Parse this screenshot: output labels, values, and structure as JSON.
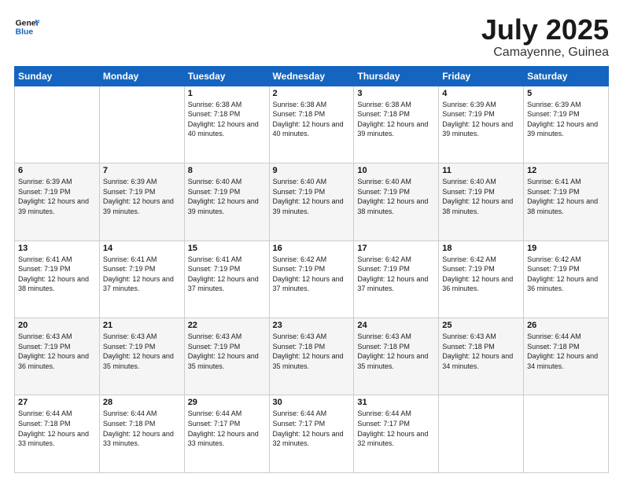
{
  "header": {
    "logo_line1": "General",
    "logo_line2": "Blue",
    "month_title": "July 2025",
    "location": "Camayenne, Guinea"
  },
  "days_of_week": [
    "Sunday",
    "Monday",
    "Tuesday",
    "Wednesday",
    "Thursday",
    "Friday",
    "Saturday"
  ],
  "weeks": [
    [
      {
        "day": "",
        "sunrise": "",
        "sunset": "",
        "daylight": ""
      },
      {
        "day": "",
        "sunrise": "",
        "sunset": "",
        "daylight": ""
      },
      {
        "day": "1",
        "sunrise": "Sunrise: 6:38 AM",
        "sunset": "Sunset: 7:18 PM",
        "daylight": "Daylight: 12 hours and 40 minutes."
      },
      {
        "day": "2",
        "sunrise": "Sunrise: 6:38 AM",
        "sunset": "Sunset: 7:18 PM",
        "daylight": "Daylight: 12 hours and 40 minutes."
      },
      {
        "day": "3",
        "sunrise": "Sunrise: 6:38 AM",
        "sunset": "Sunset: 7:18 PM",
        "daylight": "Daylight: 12 hours and 39 minutes."
      },
      {
        "day": "4",
        "sunrise": "Sunrise: 6:39 AM",
        "sunset": "Sunset: 7:19 PM",
        "daylight": "Daylight: 12 hours and 39 minutes."
      },
      {
        "day": "5",
        "sunrise": "Sunrise: 6:39 AM",
        "sunset": "Sunset: 7:19 PM",
        "daylight": "Daylight: 12 hours and 39 minutes."
      }
    ],
    [
      {
        "day": "6",
        "sunrise": "Sunrise: 6:39 AM",
        "sunset": "Sunset: 7:19 PM",
        "daylight": "Daylight: 12 hours and 39 minutes."
      },
      {
        "day": "7",
        "sunrise": "Sunrise: 6:39 AM",
        "sunset": "Sunset: 7:19 PM",
        "daylight": "Daylight: 12 hours and 39 minutes."
      },
      {
        "day": "8",
        "sunrise": "Sunrise: 6:40 AM",
        "sunset": "Sunset: 7:19 PM",
        "daylight": "Daylight: 12 hours and 39 minutes."
      },
      {
        "day": "9",
        "sunrise": "Sunrise: 6:40 AM",
        "sunset": "Sunset: 7:19 PM",
        "daylight": "Daylight: 12 hours and 39 minutes."
      },
      {
        "day": "10",
        "sunrise": "Sunrise: 6:40 AM",
        "sunset": "Sunset: 7:19 PM",
        "daylight": "Daylight: 12 hours and 38 minutes."
      },
      {
        "day": "11",
        "sunrise": "Sunrise: 6:40 AM",
        "sunset": "Sunset: 7:19 PM",
        "daylight": "Daylight: 12 hours and 38 minutes."
      },
      {
        "day": "12",
        "sunrise": "Sunrise: 6:41 AM",
        "sunset": "Sunset: 7:19 PM",
        "daylight": "Daylight: 12 hours and 38 minutes."
      }
    ],
    [
      {
        "day": "13",
        "sunrise": "Sunrise: 6:41 AM",
        "sunset": "Sunset: 7:19 PM",
        "daylight": "Daylight: 12 hours and 38 minutes."
      },
      {
        "day": "14",
        "sunrise": "Sunrise: 6:41 AM",
        "sunset": "Sunset: 7:19 PM",
        "daylight": "Daylight: 12 hours and 37 minutes."
      },
      {
        "day": "15",
        "sunrise": "Sunrise: 6:41 AM",
        "sunset": "Sunset: 7:19 PM",
        "daylight": "Daylight: 12 hours and 37 minutes."
      },
      {
        "day": "16",
        "sunrise": "Sunrise: 6:42 AM",
        "sunset": "Sunset: 7:19 PM",
        "daylight": "Daylight: 12 hours and 37 minutes."
      },
      {
        "day": "17",
        "sunrise": "Sunrise: 6:42 AM",
        "sunset": "Sunset: 7:19 PM",
        "daylight": "Daylight: 12 hours and 37 minutes."
      },
      {
        "day": "18",
        "sunrise": "Sunrise: 6:42 AM",
        "sunset": "Sunset: 7:19 PM",
        "daylight": "Daylight: 12 hours and 36 minutes."
      },
      {
        "day": "19",
        "sunrise": "Sunrise: 6:42 AM",
        "sunset": "Sunset: 7:19 PM",
        "daylight": "Daylight: 12 hours and 36 minutes."
      }
    ],
    [
      {
        "day": "20",
        "sunrise": "Sunrise: 6:43 AM",
        "sunset": "Sunset: 7:19 PM",
        "daylight": "Daylight: 12 hours and 36 minutes."
      },
      {
        "day": "21",
        "sunrise": "Sunrise: 6:43 AM",
        "sunset": "Sunset: 7:19 PM",
        "daylight": "Daylight: 12 hours and 35 minutes."
      },
      {
        "day": "22",
        "sunrise": "Sunrise: 6:43 AM",
        "sunset": "Sunset: 7:19 PM",
        "daylight": "Daylight: 12 hours and 35 minutes."
      },
      {
        "day": "23",
        "sunrise": "Sunrise: 6:43 AM",
        "sunset": "Sunset: 7:18 PM",
        "daylight": "Daylight: 12 hours and 35 minutes."
      },
      {
        "day": "24",
        "sunrise": "Sunrise: 6:43 AM",
        "sunset": "Sunset: 7:18 PM",
        "daylight": "Daylight: 12 hours and 35 minutes."
      },
      {
        "day": "25",
        "sunrise": "Sunrise: 6:43 AM",
        "sunset": "Sunset: 7:18 PM",
        "daylight": "Daylight: 12 hours and 34 minutes."
      },
      {
        "day": "26",
        "sunrise": "Sunrise: 6:44 AM",
        "sunset": "Sunset: 7:18 PM",
        "daylight": "Daylight: 12 hours and 34 minutes."
      }
    ],
    [
      {
        "day": "27",
        "sunrise": "Sunrise: 6:44 AM",
        "sunset": "Sunset: 7:18 PM",
        "daylight": "Daylight: 12 hours and 33 minutes."
      },
      {
        "day": "28",
        "sunrise": "Sunrise: 6:44 AM",
        "sunset": "Sunset: 7:18 PM",
        "daylight": "Daylight: 12 hours and 33 minutes."
      },
      {
        "day": "29",
        "sunrise": "Sunrise: 6:44 AM",
        "sunset": "Sunset: 7:17 PM",
        "daylight": "Daylight: 12 hours and 33 minutes."
      },
      {
        "day": "30",
        "sunrise": "Sunrise: 6:44 AM",
        "sunset": "Sunset: 7:17 PM",
        "daylight": "Daylight: 12 hours and 32 minutes."
      },
      {
        "day": "31",
        "sunrise": "Sunrise: 6:44 AM",
        "sunset": "Sunset: 7:17 PM",
        "daylight": "Daylight: 12 hours and 32 minutes."
      },
      {
        "day": "",
        "sunrise": "",
        "sunset": "",
        "daylight": ""
      },
      {
        "day": "",
        "sunrise": "",
        "sunset": "",
        "daylight": ""
      }
    ]
  ]
}
